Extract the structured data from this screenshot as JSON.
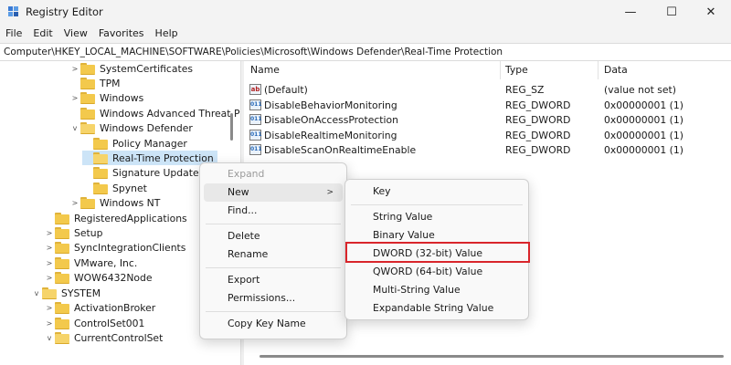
{
  "window": {
    "title": "Registry Editor",
    "minimize_glyph": "—",
    "maximize_glyph": "☐",
    "close_glyph": "✕"
  },
  "menu": [
    "File",
    "Edit",
    "View",
    "Favorites",
    "Help"
  ],
  "address": "Computer\\HKEY_LOCAL_MACHINE\\SOFTWARE\\Policies\\Microsoft\\Windows Defender\\Real-Time Protection",
  "tree": [
    {
      "label": "SystemCertificates",
      "chevron": ">"
    },
    {
      "label": "TPM",
      "chevron": ""
    },
    {
      "label": "Windows",
      "chevron": ">"
    },
    {
      "label": "Windows Advanced Threat P",
      "chevron": ""
    },
    {
      "label": "Windows Defender",
      "chevron": "v"
    },
    {
      "label": "Policy Manager",
      "chevron": ""
    },
    {
      "label": "Real-Time Protection",
      "chevron": ""
    },
    {
      "label": "Signature Updates",
      "chevron": ""
    },
    {
      "label": "Spynet",
      "chevron": ""
    },
    {
      "label": "Windows NT",
      "chevron": ">"
    },
    {
      "label": "RegisteredApplications",
      "chevron": ""
    },
    {
      "label": "Setup",
      "chevron": ">"
    },
    {
      "label": "SyncIntegrationClients",
      "chevron": ">"
    },
    {
      "label": "VMware, Inc.",
      "chevron": ">"
    },
    {
      "label": "WOW6432Node",
      "chevron": ">"
    },
    {
      "label": "SYSTEM",
      "chevron": "v"
    },
    {
      "label": "ActivationBroker",
      "chevron": ">"
    },
    {
      "label": "ControlSet001",
      "chevron": ">"
    },
    {
      "label": "CurrentControlSet",
      "chevron": "v"
    }
  ],
  "columns": {
    "name": "Name",
    "type": "Type",
    "data": "Data"
  },
  "values": [
    {
      "name": "(Default)",
      "type": "REG_SZ",
      "data": "(value not set)",
      "icon": "ab"
    },
    {
      "name": "DisableBehaviorMonitoring",
      "type": "REG_DWORD",
      "data": "0x00000001 (1)",
      "icon": "011"
    },
    {
      "name": "DisableOnAccessProtection",
      "type": "REG_DWORD",
      "data": "0x00000001 (1)",
      "icon": "011"
    },
    {
      "name": "DisableRealtimeMonitoring",
      "type": "REG_DWORD",
      "data": "0x00000001 (1)",
      "icon": "011"
    },
    {
      "name": "DisableScanOnRealtimeEnable",
      "type": "REG_DWORD",
      "data": "0x00000001 (1)",
      "icon": "011"
    }
  ],
  "context_menu": {
    "expand": "Expand",
    "new": "New",
    "find": "Find...",
    "delete": "Delete",
    "rename": "Rename",
    "export": "Export",
    "permissions": "Permissions...",
    "copy_key_name": "Copy Key Name",
    "submenu_arrow": ">"
  },
  "submenu": {
    "key": "Key",
    "string_value": "String Value",
    "binary_value": "Binary Value",
    "dword_value": "DWORD (32-bit) Value",
    "qword_value": "QWORD (64-bit) Value",
    "multi_string_value": "Multi-String Value",
    "expandable_string_value": "Expandable String Value"
  },
  "colors": {
    "highlight": "#d9252b",
    "selection": "#cce4f7",
    "folder": "#f3c94c"
  }
}
